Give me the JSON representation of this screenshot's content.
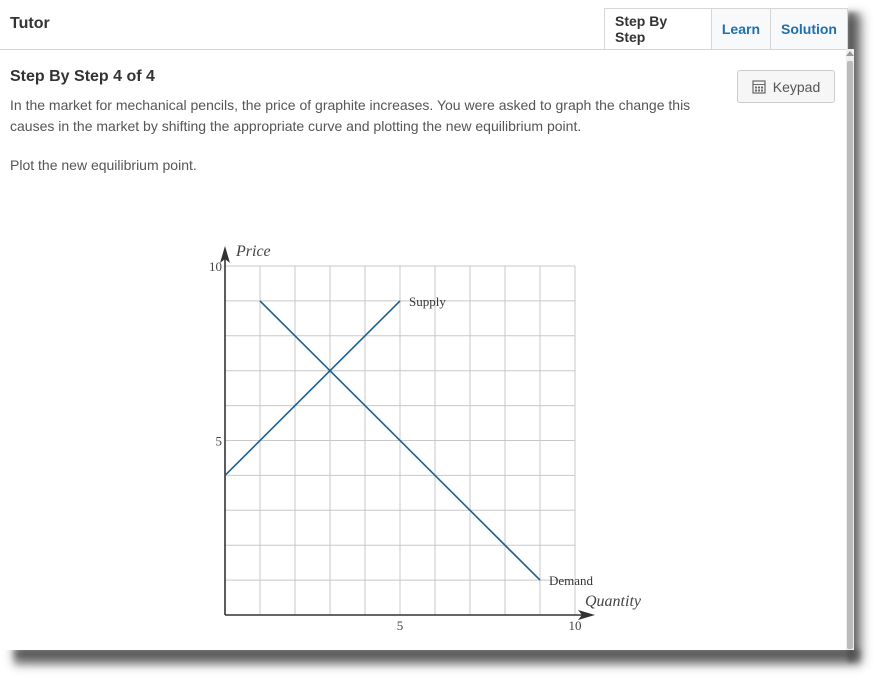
{
  "app": {
    "title": "Tutor"
  },
  "tabs": [
    {
      "label": "Step By Step",
      "active": true
    },
    {
      "label": "Learn",
      "active": false
    },
    {
      "label": "Solution",
      "active": false
    }
  ],
  "step": {
    "title": "Step By Step 4 of 4",
    "prompt": "In the market for mechanical pencils, the price of graphite increases. You were asked to graph the change this causes in the market by shifting the appropriate curve and plotting the new equilibrium point.",
    "instruction": "Plot the new equilibrium point."
  },
  "keypad": {
    "label": "Keypad",
    "icon": "calculator-icon"
  },
  "colors": {
    "curve": "#1f5f8f",
    "grid": "#c8c8c8",
    "axis": "#333333",
    "link": "#1f6fad"
  },
  "chart_data": {
    "type": "line",
    "xlabel": "Quantity",
    "ylabel": "Price",
    "xlim": [
      0,
      10
    ],
    "ylim": [
      0,
      10
    ],
    "grid": true,
    "x_ticks": [
      5,
      10
    ],
    "y_ticks": [
      5,
      10
    ],
    "series": [
      {
        "name": "Supply",
        "points": [
          [
            0,
            4
          ],
          [
            5,
            9
          ]
        ]
      },
      {
        "name": "Demand",
        "points": [
          [
            1,
            9
          ],
          [
            9,
            1
          ]
        ]
      }
    ]
  }
}
